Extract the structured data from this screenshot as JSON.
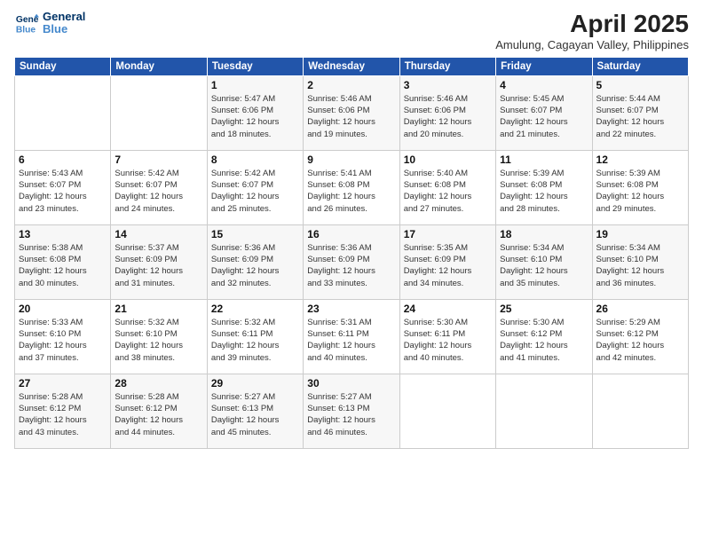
{
  "header": {
    "logo_line1": "General",
    "logo_line2": "Blue",
    "month": "April 2025",
    "location": "Amulung, Cagayan Valley, Philippines"
  },
  "weekdays": [
    "Sunday",
    "Monday",
    "Tuesday",
    "Wednesday",
    "Thursday",
    "Friday",
    "Saturday"
  ],
  "weeks": [
    [
      {
        "day": "",
        "info": ""
      },
      {
        "day": "",
        "info": ""
      },
      {
        "day": "1",
        "info": "Sunrise: 5:47 AM\nSunset: 6:06 PM\nDaylight: 12 hours\nand 18 minutes."
      },
      {
        "day": "2",
        "info": "Sunrise: 5:46 AM\nSunset: 6:06 PM\nDaylight: 12 hours\nand 19 minutes."
      },
      {
        "day": "3",
        "info": "Sunrise: 5:46 AM\nSunset: 6:06 PM\nDaylight: 12 hours\nand 20 minutes."
      },
      {
        "day": "4",
        "info": "Sunrise: 5:45 AM\nSunset: 6:07 PM\nDaylight: 12 hours\nand 21 minutes."
      },
      {
        "day": "5",
        "info": "Sunrise: 5:44 AM\nSunset: 6:07 PM\nDaylight: 12 hours\nand 22 minutes."
      }
    ],
    [
      {
        "day": "6",
        "info": "Sunrise: 5:43 AM\nSunset: 6:07 PM\nDaylight: 12 hours\nand 23 minutes."
      },
      {
        "day": "7",
        "info": "Sunrise: 5:42 AM\nSunset: 6:07 PM\nDaylight: 12 hours\nand 24 minutes."
      },
      {
        "day": "8",
        "info": "Sunrise: 5:42 AM\nSunset: 6:07 PM\nDaylight: 12 hours\nand 25 minutes."
      },
      {
        "day": "9",
        "info": "Sunrise: 5:41 AM\nSunset: 6:08 PM\nDaylight: 12 hours\nand 26 minutes."
      },
      {
        "day": "10",
        "info": "Sunrise: 5:40 AM\nSunset: 6:08 PM\nDaylight: 12 hours\nand 27 minutes."
      },
      {
        "day": "11",
        "info": "Sunrise: 5:39 AM\nSunset: 6:08 PM\nDaylight: 12 hours\nand 28 minutes."
      },
      {
        "day": "12",
        "info": "Sunrise: 5:39 AM\nSunset: 6:08 PM\nDaylight: 12 hours\nand 29 minutes."
      }
    ],
    [
      {
        "day": "13",
        "info": "Sunrise: 5:38 AM\nSunset: 6:08 PM\nDaylight: 12 hours\nand 30 minutes."
      },
      {
        "day": "14",
        "info": "Sunrise: 5:37 AM\nSunset: 6:09 PM\nDaylight: 12 hours\nand 31 minutes."
      },
      {
        "day": "15",
        "info": "Sunrise: 5:36 AM\nSunset: 6:09 PM\nDaylight: 12 hours\nand 32 minutes."
      },
      {
        "day": "16",
        "info": "Sunrise: 5:36 AM\nSunset: 6:09 PM\nDaylight: 12 hours\nand 33 minutes."
      },
      {
        "day": "17",
        "info": "Sunrise: 5:35 AM\nSunset: 6:09 PM\nDaylight: 12 hours\nand 34 minutes."
      },
      {
        "day": "18",
        "info": "Sunrise: 5:34 AM\nSunset: 6:10 PM\nDaylight: 12 hours\nand 35 minutes."
      },
      {
        "day": "19",
        "info": "Sunrise: 5:34 AM\nSunset: 6:10 PM\nDaylight: 12 hours\nand 36 minutes."
      }
    ],
    [
      {
        "day": "20",
        "info": "Sunrise: 5:33 AM\nSunset: 6:10 PM\nDaylight: 12 hours\nand 37 minutes."
      },
      {
        "day": "21",
        "info": "Sunrise: 5:32 AM\nSunset: 6:10 PM\nDaylight: 12 hours\nand 38 minutes."
      },
      {
        "day": "22",
        "info": "Sunrise: 5:32 AM\nSunset: 6:11 PM\nDaylight: 12 hours\nand 39 minutes."
      },
      {
        "day": "23",
        "info": "Sunrise: 5:31 AM\nSunset: 6:11 PM\nDaylight: 12 hours\nand 40 minutes."
      },
      {
        "day": "24",
        "info": "Sunrise: 5:30 AM\nSunset: 6:11 PM\nDaylight: 12 hours\nand 40 minutes."
      },
      {
        "day": "25",
        "info": "Sunrise: 5:30 AM\nSunset: 6:12 PM\nDaylight: 12 hours\nand 41 minutes."
      },
      {
        "day": "26",
        "info": "Sunrise: 5:29 AM\nSunset: 6:12 PM\nDaylight: 12 hours\nand 42 minutes."
      }
    ],
    [
      {
        "day": "27",
        "info": "Sunrise: 5:28 AM\nSunset: 6:12 PM\nDaylight: 12 hours\nand 43 minutes."
      },
      {
        "day": "28",
        "info": "Sunrise: 5:28 AM\nSunset: 6:12 PM\nDaylight: 12 hours\nand 44 minutes."
      },
      {
        "day": "29",
        "info": "Sunrise: 5:27 AM\nSunset: 6:13 PM\nDaylight: 12 hours\nand 45 minutes."
      },
      {
        "day": "30",
        "info": "Sunrise: 5:27 AM\nSunset: 6:13 PM\nDaylight: 12 hours\nand 46 minutes."
      },
      {
        "day": "",
        "info": ""
      },
      {
        "day": "",
        "info": ""
      },
      {
        "day": "",
        "info": ""
      }
    ]
  ]
}
